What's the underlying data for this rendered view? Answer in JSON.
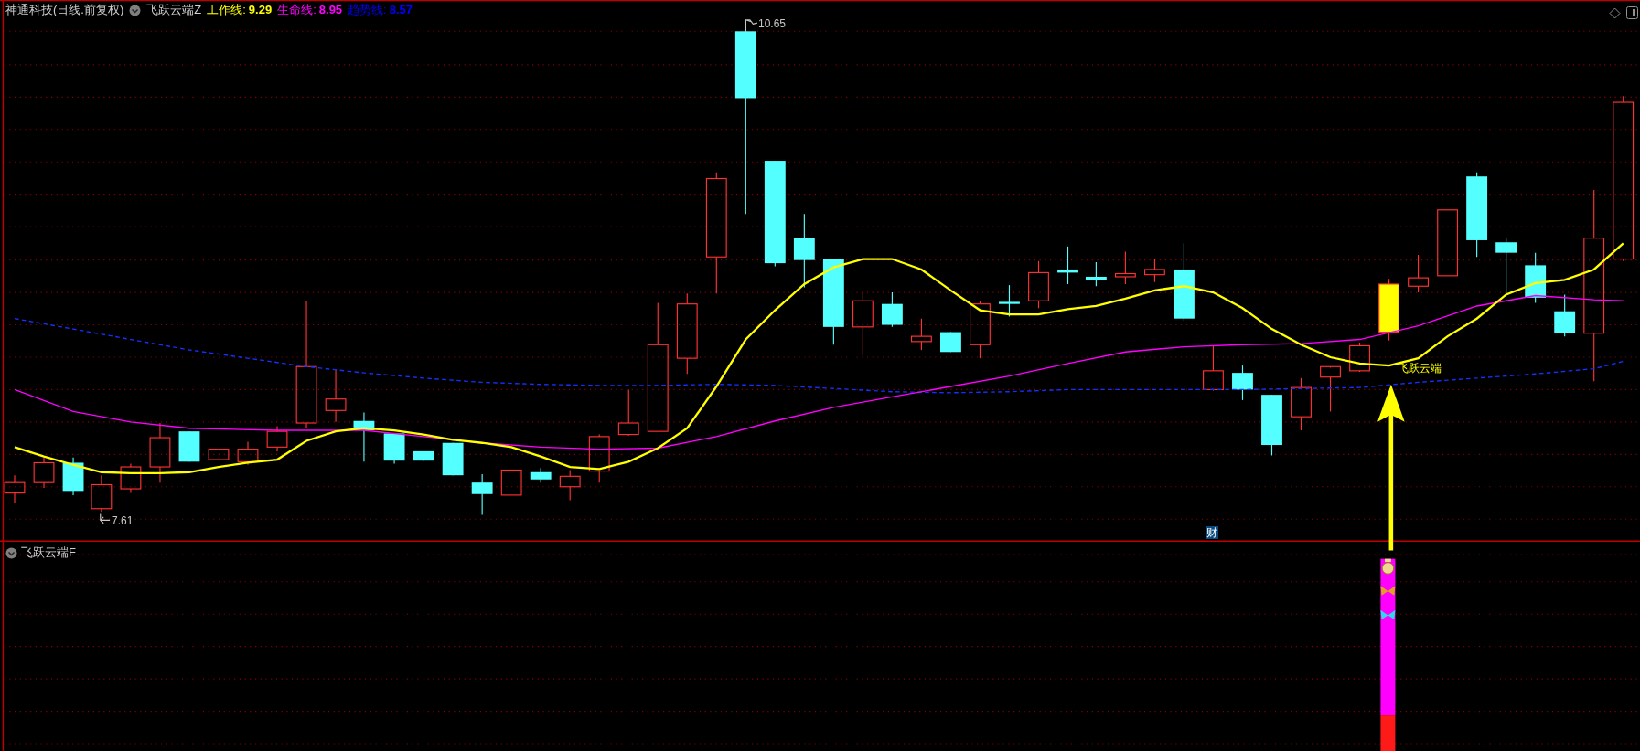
{
  "main_panel": {
    "title": "神通科技(日线.前复权)",
    "indicator": "飞跃云端Z",
    "readouts": [
      {
        "label": "工作线:",
        "value": "9.29",
        "color": "#ffff00"
      },
      {
        "label": "生命线:",
        "value": "8.95",
        "color": "#ff00ff"
      },
      {
        "label": "趋势线:",
        "value": "8.57",
        "color": "#0000ff"
      }
    ],
    "high_label": "10.65",
    "low_label": "7.61",
    "signal_label": "飞跃云端",
    "marker": "财"
  },
  "sub_panel": {
    "indicator": "飞跃云端F"
  }
}
